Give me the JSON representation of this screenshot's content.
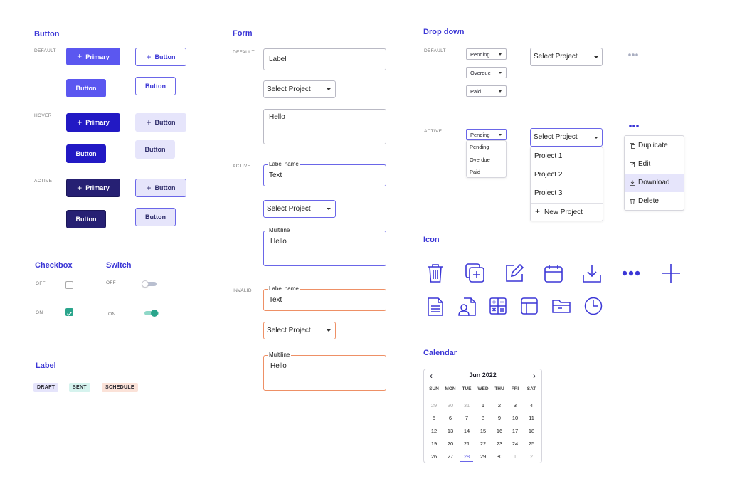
{
  "sections": {
    "button": "Button",
    "form": "Form",
    "dropdown": "Drop down",
    "checkbox": "Checkbox",
    "switch": "Switch",
    "label": "Label",
    "icon": "Icon",
    "calendar": "Calendar"
  },
  "states": {
    "default": "DEFAULT",
    "hover": "HOVER",
    "active": "ACTIVE",
    "invalid": "INVALID",
    "off": "OFF",
    "on": "ON"
  },
  "buttons": {
    "primary": "Primary",
    "button": "Button"
  },
  "labels": [
    "DRAFT",
    "SENT",
    "SCHEDULE"
  ],
  "form": {
    "label": "Label",
    "select_project": "Select Project",
    "hello": "Hello",
    "label_name": "Label name",
    "text": "Text",
    "multiline": "Multiline"
  },
  "dropdown": {
    "pending": "Pending",
    "overdue": "Overdue",
    "paid": "Paid",
    "select_project": "Select Project",
    "projects": [
      "Project 1",
      "Project 2",
      "Project 3"
    ],
    "new_project": "New Project",
    "actions": [
      "Duplicate",
      "Edit",
      "Download",
      "Delete"
    ],
    "more_icon": "more-horizontal-icon"
  },
  "icons": [
    "trash-icon",
    "copy-add-icon",
    "edit-icon",
    "calendar-icon",
    "download-icon",
    "more-icon",
    "plus-icon",
    "document-icon",
    "user-file-icon",
    "calculator-icon",
    "layout-icon",
    "folder-icon",
    "clock-icon"
  ],
  "calendar": {
    "month": "Jun 2022",
    "weekdays": [
      "SUN",
      "MON",
      "TUE",
      "WED",
      "THU",
      "FRI",
      "SAT"
    ],
    "weeks": [
      [
        "29",
        "30",
        "31",
        "1",
        "2",
        "3",
        "4"
      ],
      [
        "5",
        "6",
        "7",
        "8",
        "9",
        "10",
        "11"
      ],
      [
        "12",
        "13",
        "14",
        "15",
        "16",
        "17",
        "18"
      ],
      [
        "19",
        "20",
        "21",
        "22",
        "23",
        "24",
        "25"
      ],
      [
        "26",
        "27",
        "28",
        "29",
        "30",
        "1",
        "2"
      ]
    ],
    "selected": "28"
  },
  "colors": {
    "accent": "#3b36d6",
    "primary_default": "#5b57f0",
    "primary_hover": "#2219c4",
    "primary_active": "#262073",
    "success": "#2aa58c",
    "invalid": "#ee9066",
    "tag_draft": "#e5e4fb",
    "tag_sent": "#d6f3ee",
    "tag_schedule": "#fbe2d8"
  }
}
